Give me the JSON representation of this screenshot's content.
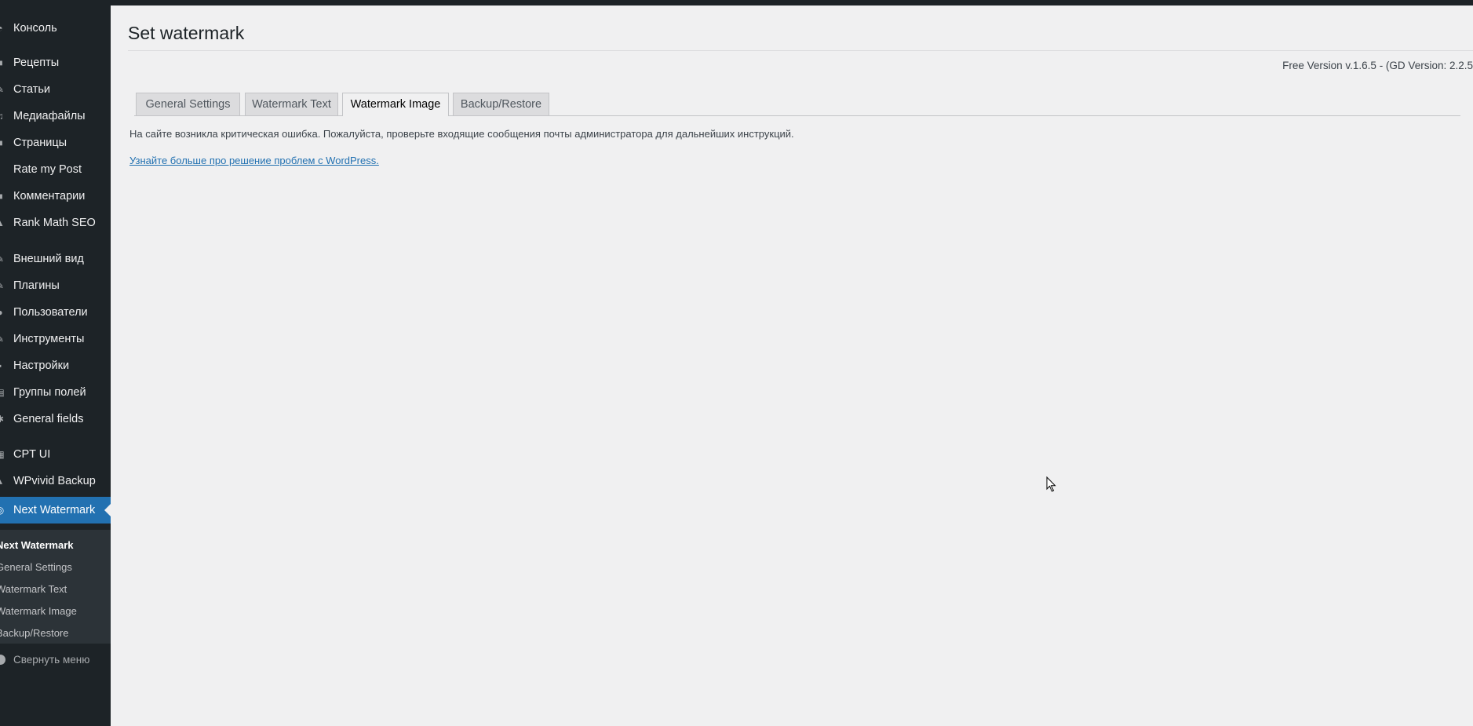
{
  "sidebar": {
    "items": [
      {
        "label": "Консоль",
        "icon": "dashboard-icon"
      },
      {
        "label": "Рецепты",
        "icon": "post-icon"
      },
      {
        "label": "Статьи",
        "icon": "pin-icon"
      },
      {
        "label": "Медиафайлы",
        "icon": "media-icon"
      },
      {
        "label": "Страницы",
        "icon": "page-icon"
      },
      {
        "label": "Rate my Post",
        "icon": "star-icon"
      },
      {
        "label": "Комментарии",
        "icon": "comments-icon"
      },
      {
        "label": "Rank Math SEO",
        "icon": "chart-icon"
      },
      {
        "label": "Внешний вид",
        "icon": "brush-icon"
      },
      {
        "label": "Плагины",
        "icon": "plugin-icon"
      },
      {
        "label": "Пользователи",
        "icon": "users-icon"
      },
      {
        "label": "Инструменты",
        "icon": "wrench-icon"
      },
      {
        "label": "Настройки",
        "icon": "settings-icon"
      },
      {
        "label": "Группы полей",
        "icon": "fields-icon"
      },
      {
        "label": "General fields",
        "icon": "gear-icon"
      },
      {
        "label": "CPT UI",
        "icon": "cpt-icon"
      },
      {
        "label": "WPvivid Backup",
        "icon": "cloud-icon"
      },
      {
        "label": "Next Watermark",
        "icon": "watermark-icon",
        "current": true
      }
    ],
    "submenu": [
      {
        "label": "Next Watermark",
        "current": true
      },
      {
        "label": "General Settings"
      },
      {
        "label": "Watermark Text"
      },
      {
        "label": "Watermark Image"
      },
      {
        "label": "Backup/Restore"
      }
    ],
    "collapse_label": "Свернуть меню"
  },
  "page": {
    "title": "Set watermark",
    "version": "Free Version v.1.6.5 - (GD Version: 2.2.5"
  },
  "tabs": [
    {
      "label": "General Settings",
      "active": false
    },
    {
      "label": "Watermark Text",
      "active": false
    },
    {
      "label": "Watermark Image",
      "active": true
    },
    {
      "label": "Backup/Restore",
      "active": false
    }
  ],
  "error": {
    "message": "На сайте возникла критическая ошибка. Пожалуйста, проверьте входящие сообщения почты администратора для дальнейших инструкций.",
    "link": "Узнайте больше про решение проблем с WordPress."
  },
  "colors": {
    "sidebar_bg": "#1d2327",
    "accent": "#2271b1",
    "content_bg": "#f0f0f1"
  }
}
